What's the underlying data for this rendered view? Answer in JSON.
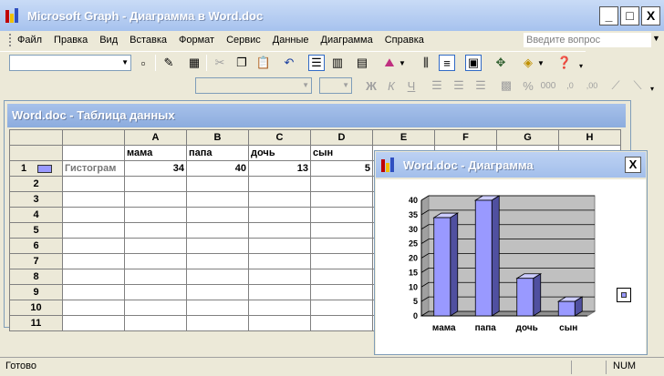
{
  "window": {
    "title": "Microsoft Graph - Диаграмма в Word.doc",
    "min_label": "_",
    "max_label": "□",
    "close_label": "X"
  },
  "menu": {
    "items": [
      {
        "label": "Файл"
      },
      {
        "label": "Правка"
      },
      {
        "label": "Вид"
      },
      {
        "label": "Вставка"
      },
      {
        "label": "Формат"
      },
      {
        "label": "Сервис"
      },
      {
        "label": "Данные"
      },
      {
        "label": "Диаграмма"
      },
      {
        "label": "Справка"
      }
    ],
    "question_placeholder": "Введите вопрос"
  },
  "datasheet": {
    "title": "Word.doc - Таблица данных",
    "columns": [
      "A",
      "B",
      "C",
      "D",
      "E",
      "F",
      "G",
      "H"
    ],
    "categories": [
      "мама",
      "папа",
      "дочь",
      "сын"
    ],
    "rows": [
      "1",
      "2",
      "3",
      "4",
      "5",
      "6",
      "7",
      "8",
      "9",
      "10",
      "11"
    ],
    "series_label": "Гистограм",
    "values": [
      "34",
      "40",
      "13",
      "5"
    ]
  },
  "chart_window": {
    "title": "Word.doc - Диаграмма",
    "close_label": "X"
  },
  "chart_data": {
    "type": "bar",
    "categories": [
      "мама",
      "папа",
      "дочь",
      "сын"
    ],
    "values": [
      34,
      40,
      13,
      5
    ],
    "ylim": [
      0,
      40
    ],
    "yticks": [
      "0",
      "5",
      "10",
      "15",
      "20",
      "25",
      "30",
      "35",
      "40"
    ],
    "grid": true,
    "legend": "right",
    "bar_color": "#9999ff",
    "wall_color": "#c0c0c0"
  },
  "status": {
    "text": "Готово",
    "num": "NUM"
  },
  "colors": {
    "title_bar": "#a6c2ee",
    "face": "#ece9d8"
  }
}
